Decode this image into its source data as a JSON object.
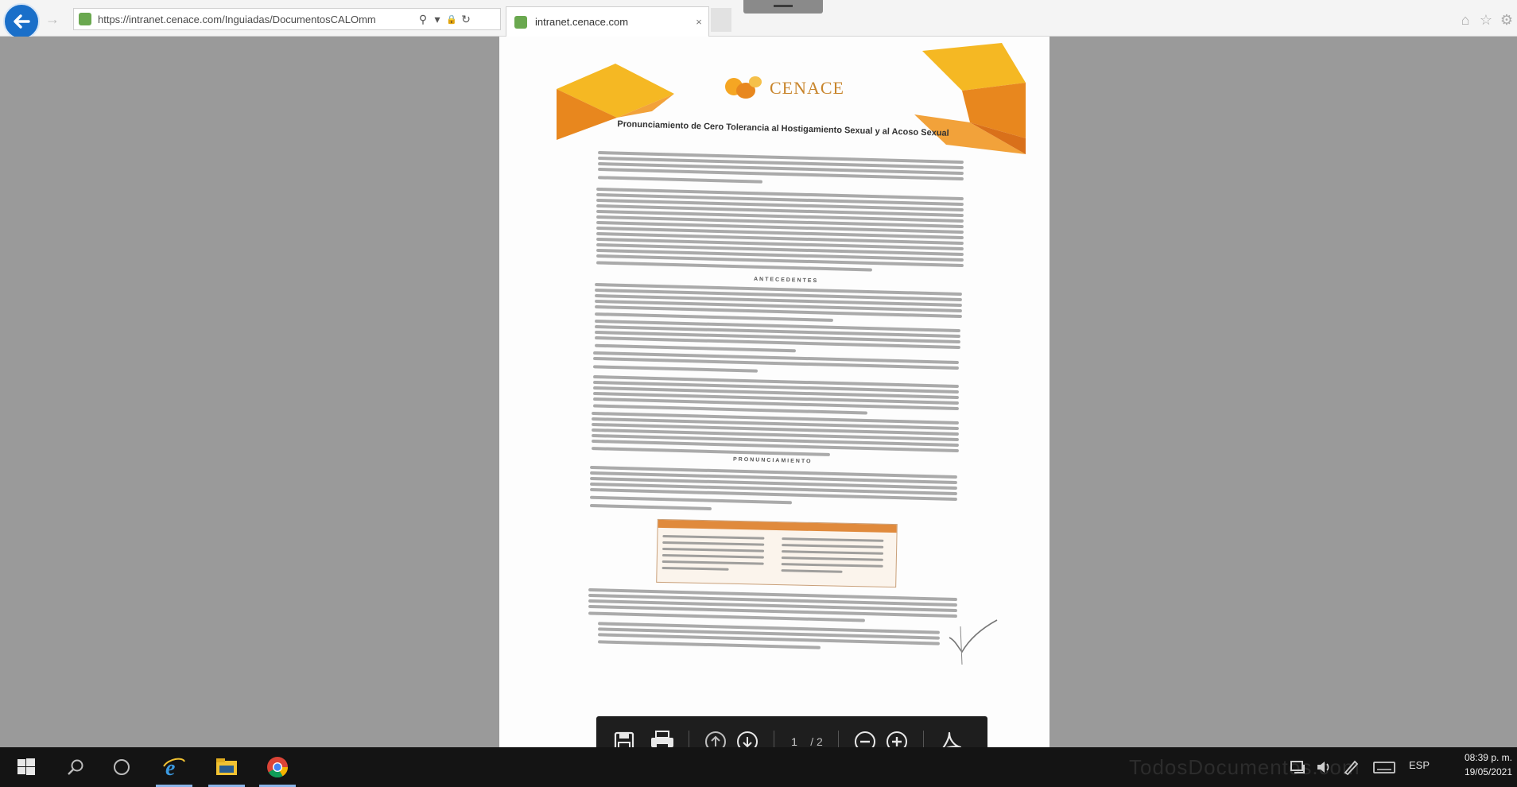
{
  "browser": {
    "url": "https://intranet.cenace.com/Inguiadas/DocumentosCALOmm",
    "tab_title": "intranet.cenace.com",
    "tab_close": "×",
    "back_icon": "arrow-left-icon",
    "forward_icon": "arrow-right-icon",
    "search_glyph": "⚲",
    "dropdown_glyph": "▾",
    "lock_glyph": "🔒",
    "refresh_glyph": "↻",
    "forward_glyph": "→",
    "home_glyph": "⌂",
    "star_glyph": "☆",
    "settings_glyph": "⚙"
  },
  "document": {
    "logo_text": "CENACE",
    "title": "Pronunciamiento de Cero Tolerancia al Hostigamiento Sexual y al Acoso Sexual",
    "section_1": "ANTECEDENTES",
    "section_2": "PRONUNCIAMIENTO",
    "table_header_color": "#e08a3c"
  },
  "pdf_toolbar": {
    "page_number": "1",
    "page_total": "/ 2",
    "icons": [
      "save-icon",
      "print-icon",
      "page-up-icon",
      "page-down-icon",
      "zoom-out-icon",
      "zoom-in-icon",
      "adobe-acrobat-icon"
    ]
  },
  "taskbar": {
    "watermark": "TodosDocumentos.com",
    "language": "ESP",
    "time": "08:39 p. m.",
    "date": "19/05/2021",
    "icons": [
      "windows-start-icon",
      "search-icon",
      "task-view-icon",
      "internet-explorer-icon",
      "file-explorer-icon",
      "chrome-icon"
    ]
  },
  "colors": {
    "ie_blue": "#1a6fc9",
    "cenace_orange": "#e8871e",
    "cenace_yellow": "#f5b823",
    "taskbar": "#141414"
  }
}
